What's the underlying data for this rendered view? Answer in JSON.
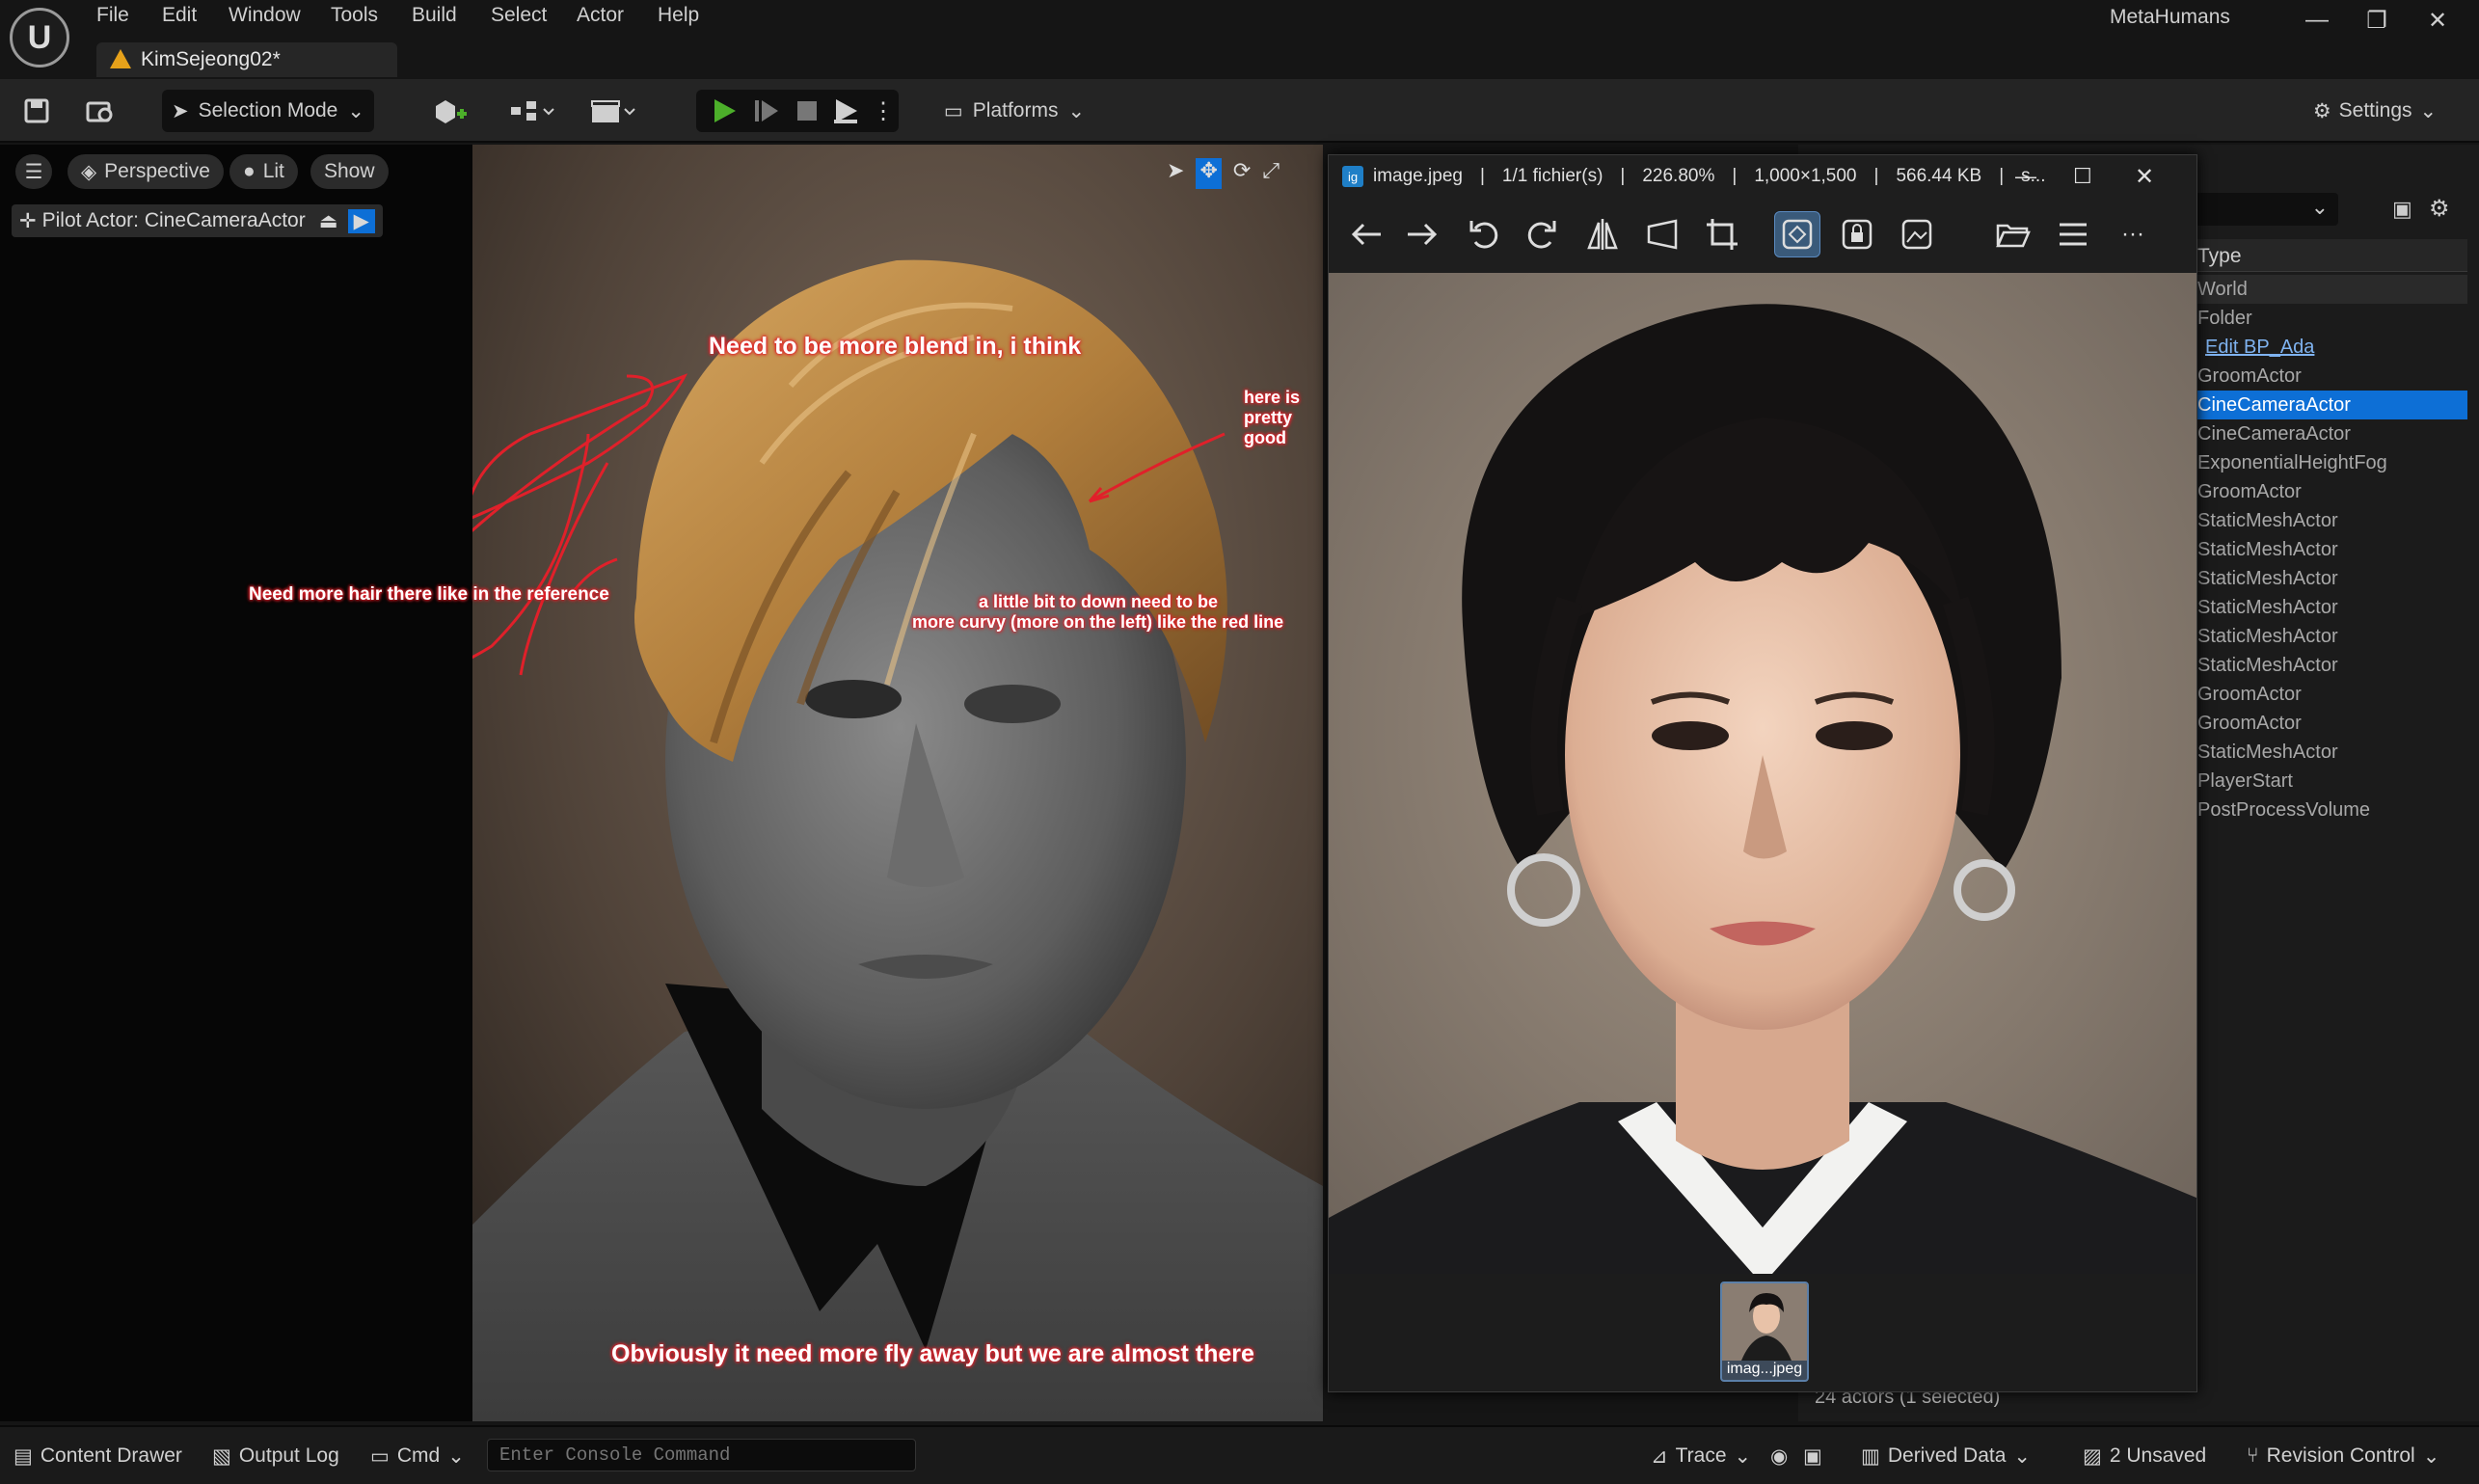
{
  "app": {
    "name": "MetaHumans",
    "document_tab": "KimSejeong02*",
    "menu": [
      "File",
      "Edit",
      "Window",
      "Tools",
      "Build",
      "Select",
      "Actor",
      "Help"
    ]
  },
  "toolbar": {
    "selection_mode": "Selection Mode",
    "platforms": "Platforms",
    "settings": "Settings"
  },
  "viewport": {
    "perspective": "Perspective",
    "lit": "Lit",
    "show": "Show",
    "pilot_actor": "Pilot Actor: CineCameraActor",
    "annotations": {
      "top": "Need to be more blend in, i think",
      "right": "here is pretty good",
      "left": "Need more hair there like in the reference",
      "middle_line1": "a little bit to down need to be",
      "middle_line2": "more curvy (more on the left) like the red line",
      "bottom": "Obviously it need more fly away but we are almost there"
    }
  },
  "image_viewer": {
    "title": {
      "filename": "image.jpeg",
      "index": "1/1 fichier(s)",
      "zoom": "226.80%",
      "dimensions": "1,000×1,500",
      "filesize": "566.44 KB",
      "more": "s..."
    },
    "thumbnail_label": "imag...jpeg",
    "icons": [
      "back-arrow",
      "forward-arrow",
      "rotate-left",
      "rotate-right",
      "flip",
      "perspective",
      "crop",
      "fit-view",
      "lock",
      "gallery",
      "open-folder",
      "menu",
      "more"
    ]
  },
  "outliner": {
    "type_header": "Type",
    "types": [
      "World",
      "Folder",
      "Edit BP_Ada",
      "GroomActor",
      "CineCameraActor",
      "CineCameraActor",
      "ExponentialHeightFog",
      "GroomActor",
      "StaticMeshActor",
      "StaticMeshActor",
      "StaticMeshActor",
      "StaticMeshActor",
      "StaticMeshActor",
      "StaticMeshActor",
      "GroomActor",
      "GroomActor",
      "StaticMeshActor",
      "PlayerStart",
      "PostProcessVolume"
    ],
    "selected_index": 4,
    "actor_count": "24 actors (1 selected)"
  },
  "statusbar": {
    "content_drawer": "Content Drawer",
    "output_log": "Output Log",
    "cmd": "Cmd",
    "console_placeholder": "Enter Console Command",
    "trace": "Trace",
    "derived_data": "Derived Data",
    "unsaved": "2 Unsaved",
    "revision_control": "Revision Control"
  },
  "colors": {
    "accent_blue": "#0d6fd6",
    "annotation_red": "#e0202a",
    "play_green": "#4caf2a",
    "warning_orange": "#e6a11a"
  }
}
